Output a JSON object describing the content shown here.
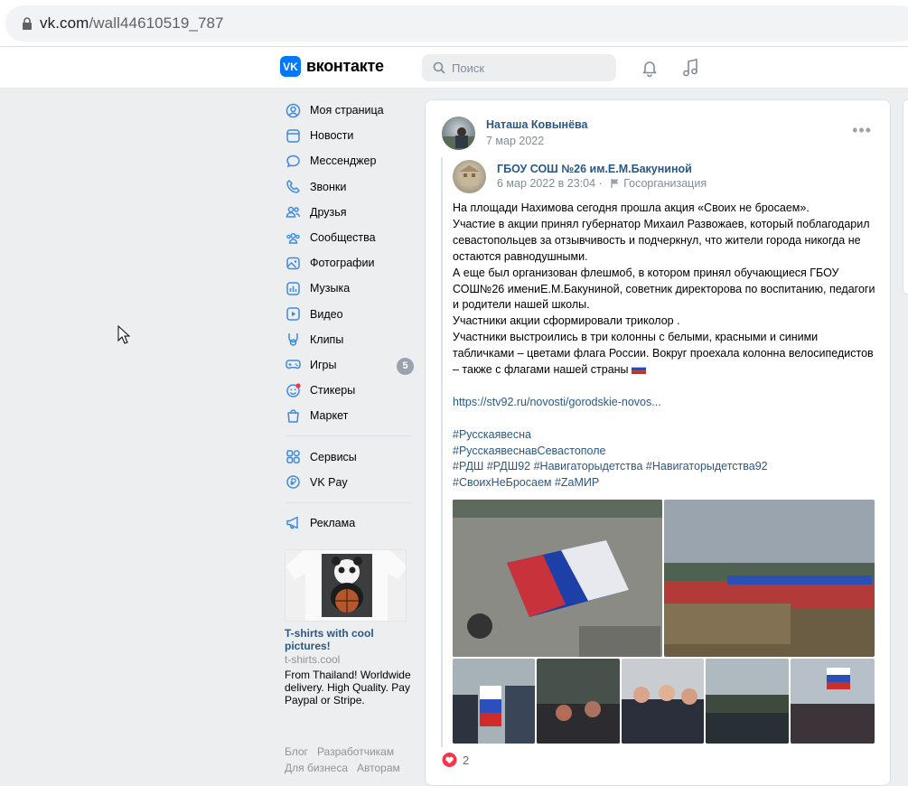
{
  "browser": {
    "url_main": "vk.com",
    "url_path": "/wall44610519_787"
  },
  "header": {
    "logo_text": "вконтакте",
    "search_placeholder": "Поиск"
  },
  "nav": {
    "items": [
      {
        "label": "Моя страница",
        "icon": "user-circle-icon"
      },
      {
        "label": "Новости",
        "icon": "news-icon"
      },
      {
        "label": "Мессенджер",
        "icon": "chat-icon"
      },
      {
        "label": "Звонки",
        "icon": "phone-icon"
      },
      {
        "label": "Друзья",
        "icon": "friends-icon"
      },
      {
        "label": "Сообщества",
        "icon": "groups-icon"
      },
      {
        "label": "Фотографии",
        "icon": "photo-icon"
      },
      {
        "label": "Музыка",
        "icon": "music-icon"
      },
      {
        "label": "Видео",
        "icon": "video-icon"
      },
      {
        "label": "Клипы",
        "icon": "clips-icon"
      },
      {
        "label": "Игры",
        "icon": "gamepad-icon",
        "badge": "5"
      },
      {
        "label": "Стикеры",
        "icon": "sticker-icon"
      },
      {
        "label": "Маркет",
        "icon": "market-icon"
      }
    ],
    "items2": [
      {
        "label": "Сервисы",
        "icon": "services-icon"
      },
      {
        "label": "VK Pay",
        "icon": "vkpay-icon"
      }
    ],
    "items3": [
      {
        "label": "Реклама",
        "icon": "megaphone-icon"
      }
    ]
  },
  "ad": {
    "title": "T-shirts with cool pictures!",
    "source": "t-shirts.cool",
    "text": "From Thailand! Worldwide delivery. High Quality. Pay Paypal or Stripe."
  },
  "footer": {
    "l1a": "Блог",
    "l1b": "Разработчикам",
    "l2a": "Для бизнеса",
    "l2b": "Авторам"
  },
  "post": {
    "author": "Наташа Ковынёва",
    "date": "7 мар 2022",
    "repost": {
      "group": "ГБОУ СОШ №26 им.Е.М.Бакуниной",
      "date": "6 мар 2022 в 23:04",
      "org": "Госорганизация",
      "p1": "На площади Нахимова сегодня прошла акция «Своих не бросаем».",
      "p2": "Участие в акции принял губернатор Михаил Развожаев, который поблагодарил севастопольцев за отзывчивость и подчеркнул, что жители города никогда не остаются равнодушными.",
      "p3": "А еще был организован флешмоб, в котором принял обучающиеся ГБОУ СОШ№26 имениЕ.М.Бакуниной, советник директорова по воспитанию, педагоги и родители нашей школы.",
      "p4": "Участники акции сформировали триколор .",
      "p5": "Участники выстроились в три колонны с белыми, красными и синими табличками – цветами флага России. Вокруг проехала колонна велосипедистов – также с флагами нашей страны",
      "link": "https://stv92.ru/novosti/gorodskie-novos...",
      "tag1": "#Русскаявесна",
      "tag2": "#РусскаявеснавСевастополе",
      "tag3": "#РДШ #РДШ92 #Навигаторыдетства #Навигаторыдетства92",
      "tag4": "#СвоихНеБросаем #ZаМИР"
    },
    "likes": "2"
  },
  "colors": {
    "accent": "#0077ff",
    "link": "#2a5885",
    "bg": "#edeef0"
  }
}
